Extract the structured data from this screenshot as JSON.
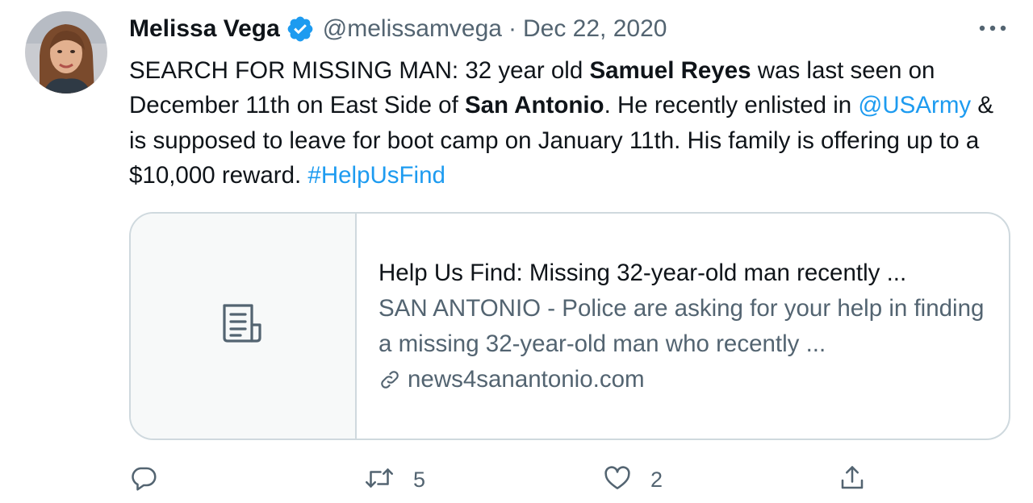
{
  "tweet": {
    "author": {
      "name": "Melissa Vega",
      "handle": "@melissamvega",
      "verified": true
    },
    "separator": "·",
    "date": "Dec 22, 2020",
    "text": {
      "part1": "SEARCH FOR MISSING MAN: 32 year old ",
      "bold1": "Samuel Reyes",
      "part2": " was last seen on December 11th on East Side of ",
      "bold2": "San Antonio",
      "part3": ". He recently enlisted in ",
      "mention": "@USArmy",
      "part4": " & is supposed to leave for boot camp on January 11th. His family is offering up to a $10,000 reward. ",
      "hashtag": "#HelpUsFind"
    },
    "card": {
      "title": "Help Us Find: Missing 32-year-old man recently ...",
      "description": "SAN ANTONIO - Police are asking for your help in finding a missing 32-year-old man who recently ...",
      "domain": "news4sanantonio.com",
      "thumbnail_icon": "article-icon"
    },
    "stats": {
      "retweets": "5",
      "likes": "2"
    }
  },
  "colors": {
    "link": "#1d9bf0",
    "secondary_text": "#536471",
    "border": "#cfd9de"
  }
}
